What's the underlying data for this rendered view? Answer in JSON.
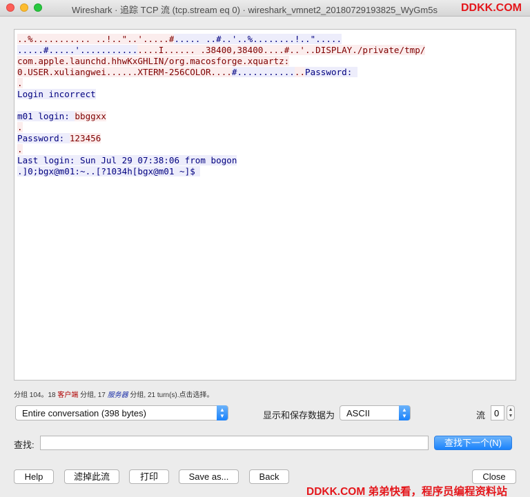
{
  "window": {
    "title": "Wireshark · 追踪 TCP 流 (tcp.stream eq 0) · wireshark_vmnet2_20180729193825_WyGm5s",
    "watermark_top": "DDKK.COM"
  },
  "stream_lines": [
    {
      "segments": [
        {
          "side": "cli",
          "text": "..%........... ..!..\"..'.....#"
        },
        {
          "side": "srv",
          "text": "..... ..#..'..%........!..\"....."
        }
      ]
    },
    {
      "segments": [
        {
          "side": "srv",
          "text": ".....#.....'..........."
        },
        {
          "side": "cli",
          "text": "....I...... .38400,38400....#..'..DISPLAY./private/tmp/"
        }
      ]
    },
    {
      "segments": [
        {
          "side": "cli",
          "text": "com.apple.launchd.hhwKxGHLIN/org.macosforge.xquartz:"
        }
      ]
    },
    {
      "segments": [
        {
          "side": "cli",
          "text": "0.USER.xuliangwei......XTERM-256COLOR...."
        },
        {
          "side": "srv",
          "text": "#..........."
        },
        {
          "side": "cli",
          "text": ".."
        },
        {
          "side": "srv",
          "text": "Password: "
        }
      ]
    },
    {
      "segments": [
        {
          "side": "cli",
          "text": "."
        }
      ]
    },
    {
      "segments": [
        {
          "side": "srv",
          "text": "Login incorrect"
        }
      ]
    },
    {
      "segments": []
    },
    {
      "segments": [
        {
          "side": "srv",
          "text": "m01 login: "
        },
        {
          "side": "cli",
          "text": "bbggxx"
        }
      ]
    },
    {
      "segments": [
        {
          "side": "cli",
          "text": "."
        }
      ]
    },
    {
      "segments": [
        {
          "side": "srv",
          "text": "Password: "
        },
        {
          "side": "cli",
          "text": "123456"
        }
      ]
    },
    {
      "segments": [
        {
          "side": "cli",
          "text": "."
        }
      ]
    },
    {
      "segments": [
        {
          "side": "srv",
          "text": "Last login: Sun Jul 29 07:38:06 from bogon"
        }
      ]
    },
    {
      "segments": [
        {
          "side": "srv",
          "text": ".]0;bgx@m01:~..[?1034h[bgx@m01 ~]$ "
        }
      ]
    }
  ],
  "stats": {
    "prefix": "分组 104。18 ",
    "client_label": "客户端",
    "middle": " 分组, 17 ",
    "server_label": "服务器",
    "suffix": " 分组, 21 turn(s).点击选择。"
  },
  "controls": {
    "conversation_select": "Entire conversation (398 bytes)",
    "display_label": "显示和保存数据为",
    "format_select": "ASCII",
    "stream_label": "流",
    "stream_value": "0",
    "find_label": "查找:",
    "find_value": "",
    "find_next": "查找下一个(N)"
  },
  "buttons": {
    "help": "Help",
    "filter_out": "滤掉此流",
    "print": "打印",
    "save_as": "Save as...",
    "back": "Back",
    "close": "Close"
  },
  "watermark_bottom": "DDKK.COM 弟弟快看，程序员编程资料站",
  "colors": {
    "client_fg": "#7f0000",
    "client_bg": "#fbeded",
    "server_fg": "#00007f",
    "server_bg": "#ededfb",
    "accent": "#1a82fb"
  }
}
